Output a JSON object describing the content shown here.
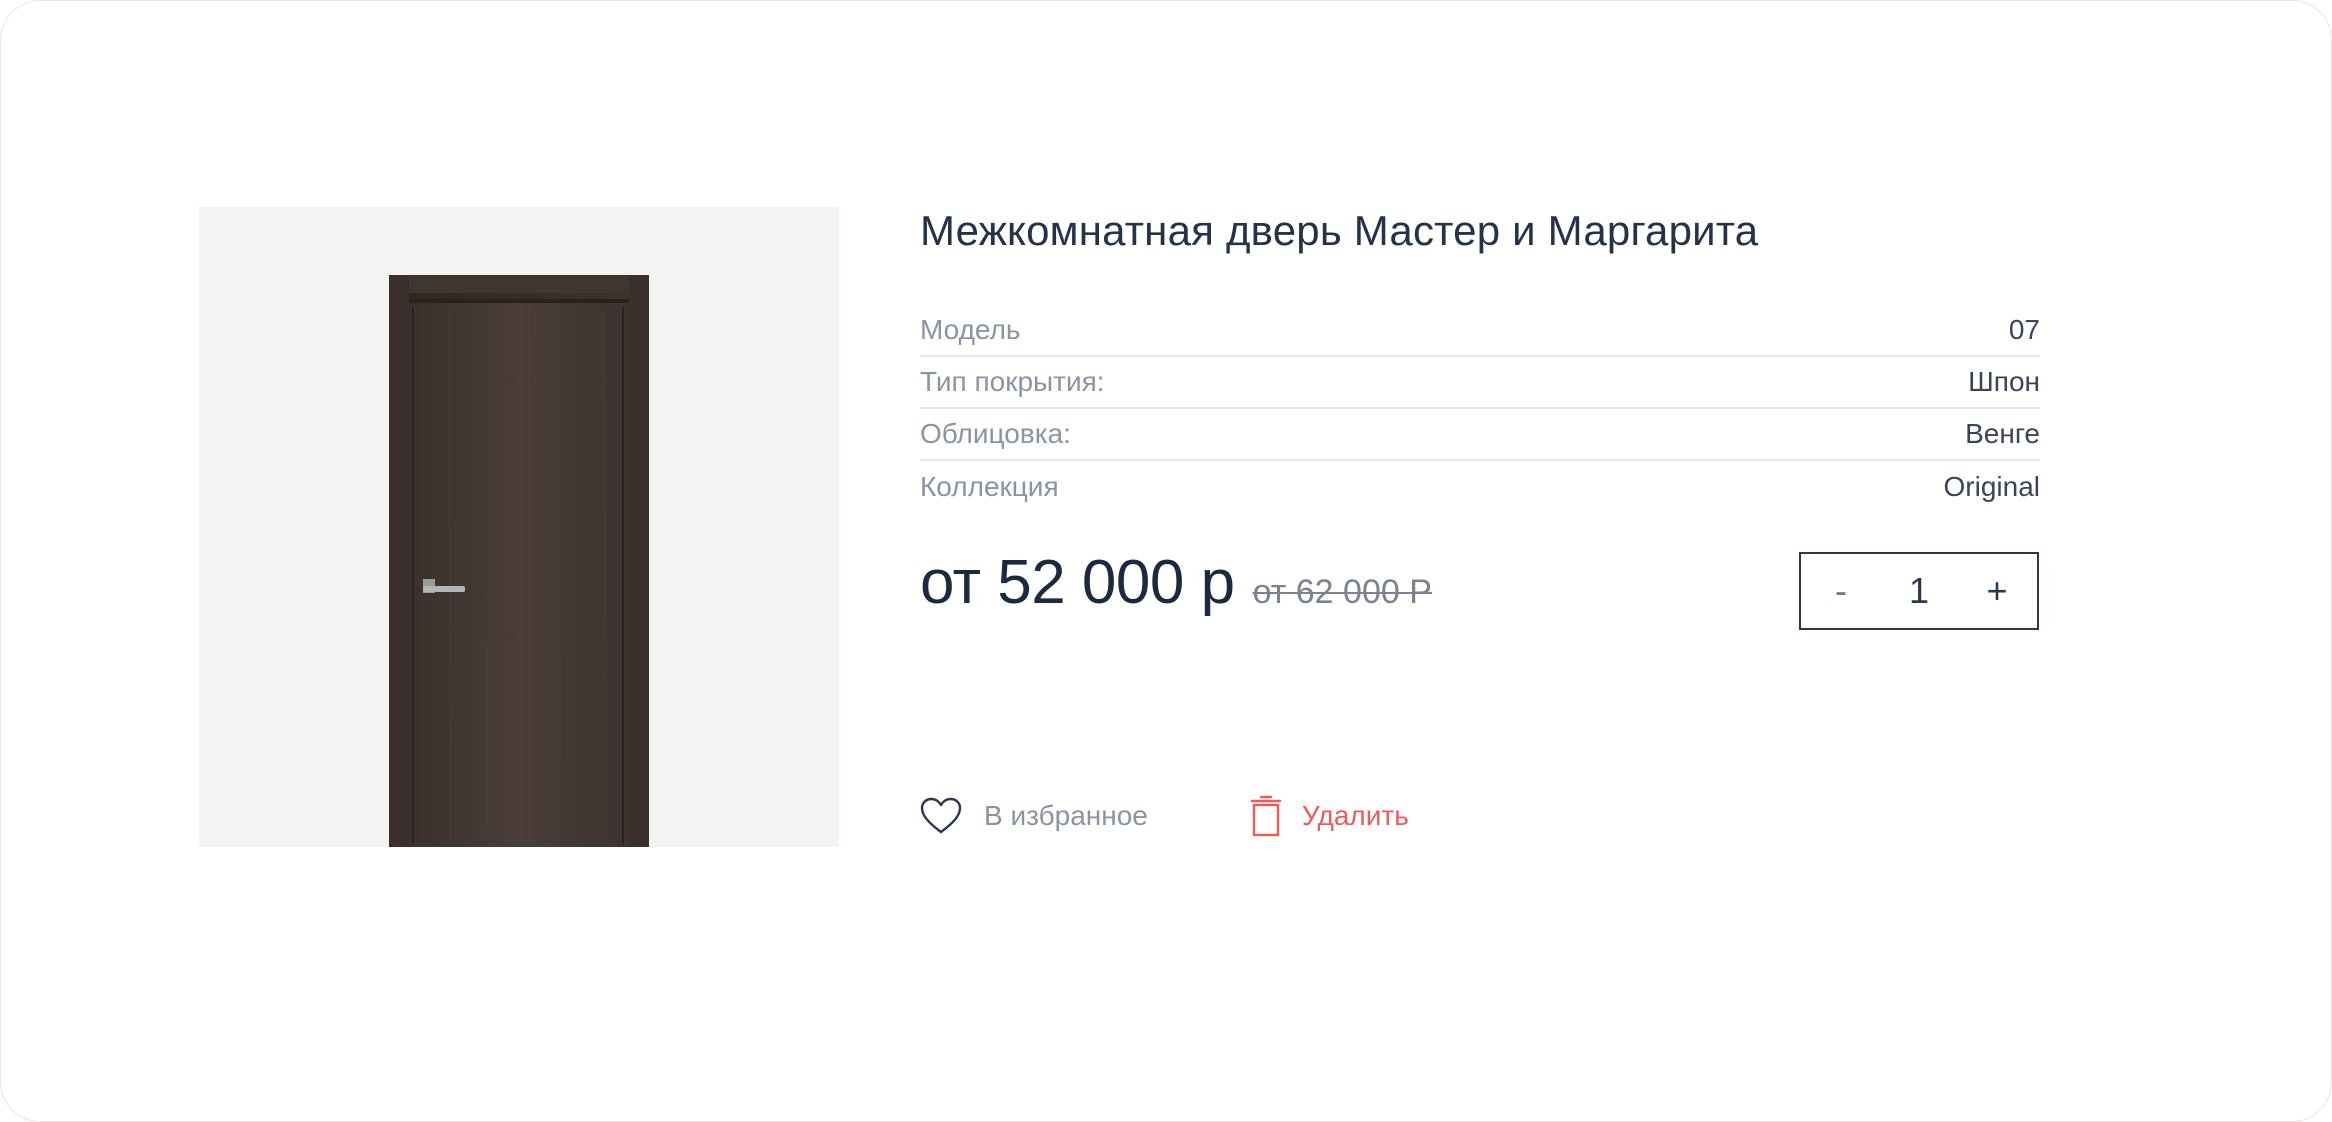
{
  "product": {
    "title": "Межкомнатная дверь Мастер и Маргарита",
    "image_alt": "door"
  },
  "properties": [
    {
      "label": "Модель",
      "value": "07"
    },
    {
      "label": "Тип покрытия:",
      "value": "Шпон"
    },
    {
      "label": "Облицовка:",
      "value": "Венге"
    },
    {
      "label": "Коллекция",
      "value": "Original"
    }
  ],
  "price": {
    "current": "от 52 000 р",
    "old": "от 62 000 Р"
  },
  "quantity": {
    "minus_label": "-",
    "value": "1",
    "plus_label": "+"
  },
  "actions": {
    "favorite_label": "В избранное",
    "favorite_icon": "heart-icon",
    "delete_label": "Удалить",
    "delete_icon": "trash-icon"
  },
  "colors": {
    "text_dark": "#1c2a40",
    "text_muted": "#8a94a3",
    "danger": "#ef5a5a",
    "image_bg": "#f4f3f1"
  }
}
